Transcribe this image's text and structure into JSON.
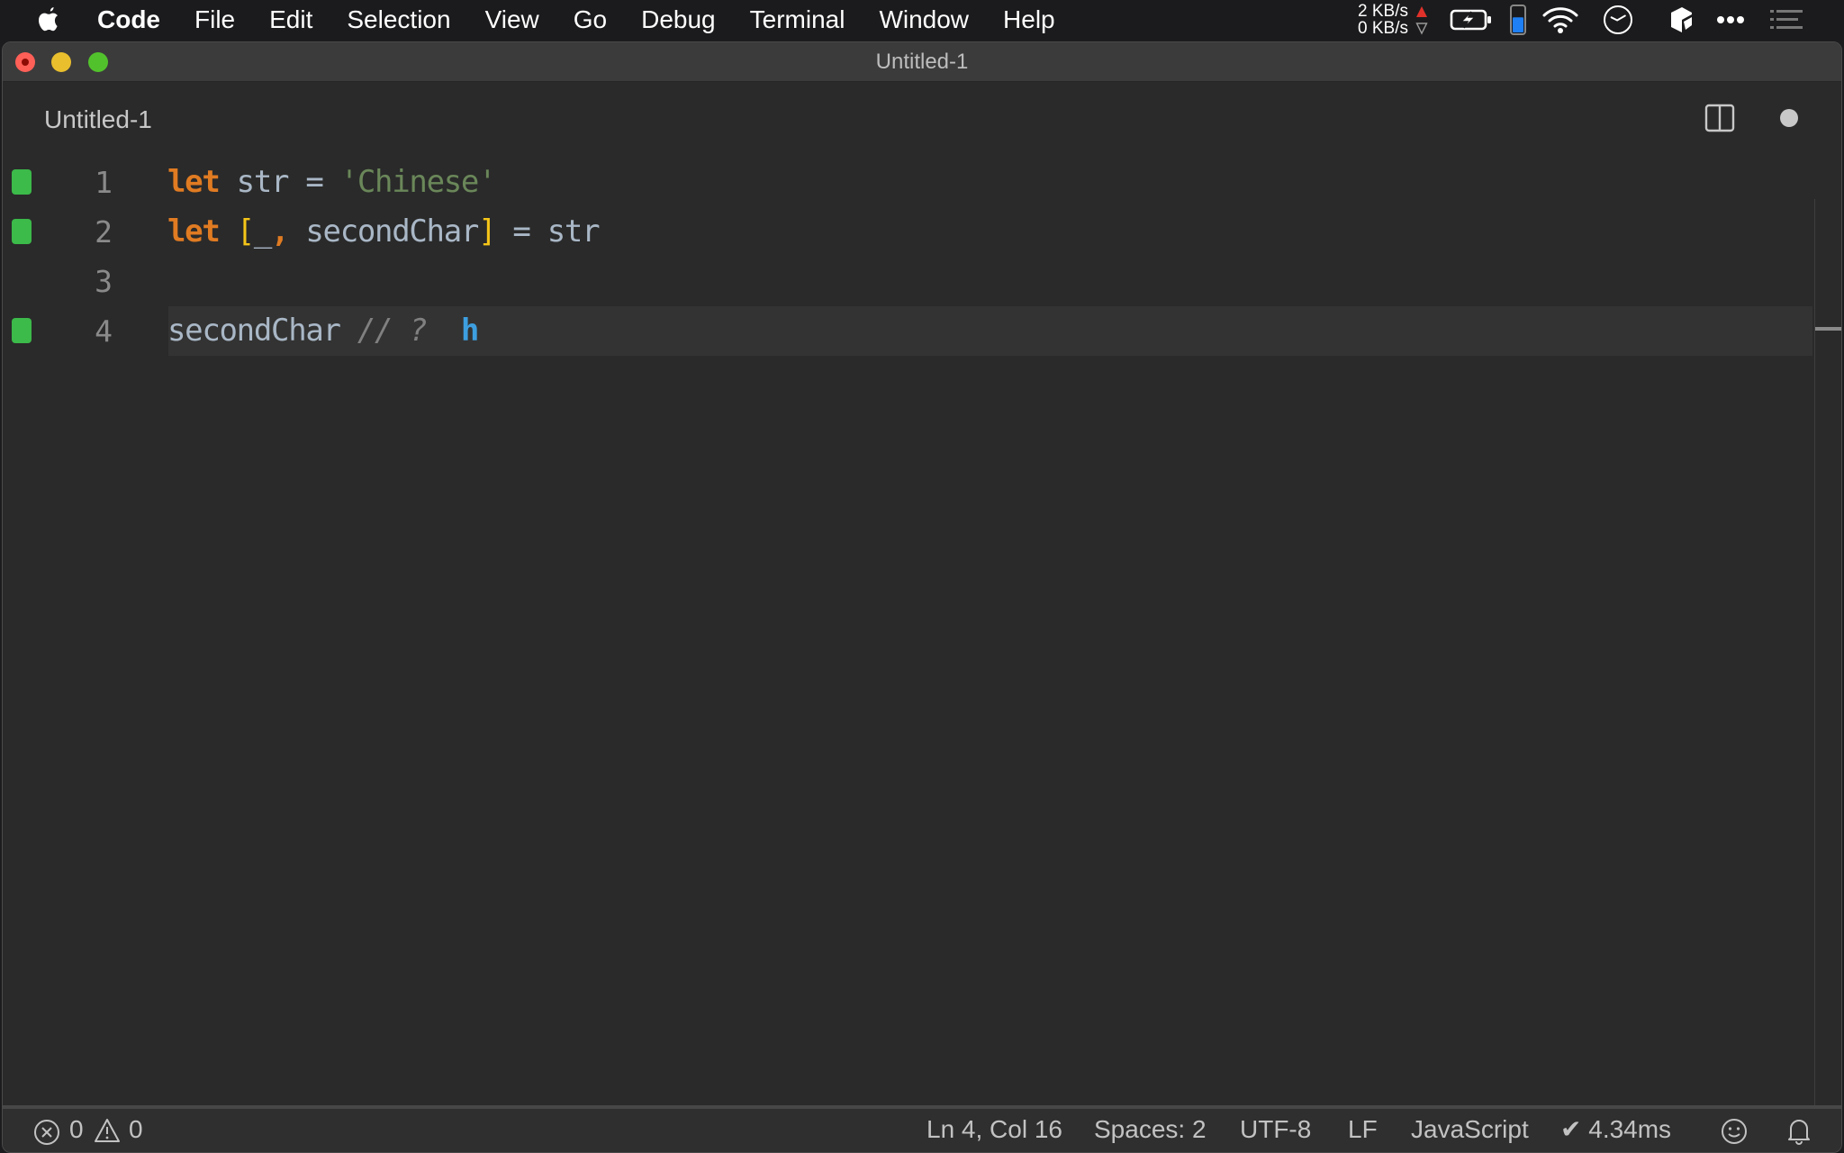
{
  "menubar": {
    "items": [
      {
        "label": "Code",
        "bold": true
      },
      {
        "label": "File"
      },
      {
        "label": "Edit"
      },
      {
        "label": "Selection"
      },
      {
        "label": "View"
      },
      {
        "label": "Go"
      },
      {
        "label": "Debug"
      },
      {
        "label": "Terminal"
      },
      {
        "label": "Window"
      },
      {
        "label": "Help"
      }
    ],
    "tray": {
      "upload_speed": "2 KB/s",
      "download_speed": "0 KB/s",
      "icons": [
        "battery-charging-icon",
        "battery-level-icon",
        "wifi-icon",
        "clock-icon",
        "cube-app-icon",
        "more-icon",
        "notification-center-icon"
      ],
      "battery_level_fraction": 0.6,
      "accent_up": "#e0312a",
      "accent_meter": "#1f7ff5"
    }
  },
  "window": {
    "title": "Untitled-1",
    "tab": {
      "label": "Untitled-1",
      "dirty": true
    }
  },
  "editor": {
    "lines": [
      {
        "number": "1",
        "marker": true,
        "tokens": [
          {
            "t": "let",
            "c": "kw"
          },
          {
            "t": " str ",
            "c": "op"
          },
          {
            "t": "=",
            "c": "op"
          },
          {
            "t": " ",
            "c": "op"
          },
          {
            "t": "'Chinese'",
            "c": "str"
          }
        ]
      },
      {
        "number": "2",
        "marker": true,
        "tokens": [
          {
            "t": "let",
            "c": "kw"
          },
          {
            "t": " ",
            "c": "op"
          },
          {
            "t": "[",
            "c": "br"
          },
          {
            "t": "_",
            "c": "op"
          },
          {
            "t": ",",
            "c": "kw"
          },
          {
            "t": " secondChar",
            "c": "op"
          },
          {
            "t": "]",
            "c": "br"
          },
          {
            "t": " = str",
            "c": "op"
          }
        ]
      },
      {
        "number": "3",
        "marker": false,
        "tokens": []
      },
      {
        "number": "4",
        "marker": true,
        "current": true,
        "tokens": [
          {
            "t": "secondChar ",
            "c": "op"
          },
          {
            "t": "// ?",
            "c": "cm"
          },
          {
            "t": "  ",
            "c": "op"
          },
          {
            "t": "h",
            "c": "res"
          }
        ]
      }
    ],
    "colors": {
      "keyword": "#e07b22",
      "string": "#6a8759",
      "bracket": "#f5c518",
      "comment": "#808080",
      "result": "#3d9fe0",
      "identifier": "#a9b7c6",
      "marker": "#3cba4a"
    }
  },
  "statusbar": {
    "errors": "0",
    "warnings": "0",
    "cursor": "Ln 4, Col 16",
    "indent": "Spaces: 2",
    "encoding": "UTF-8",
    "eol": "LF",
    "language": "JavaScript",
    "timing": "✔ 4.34ms"
  }
}
